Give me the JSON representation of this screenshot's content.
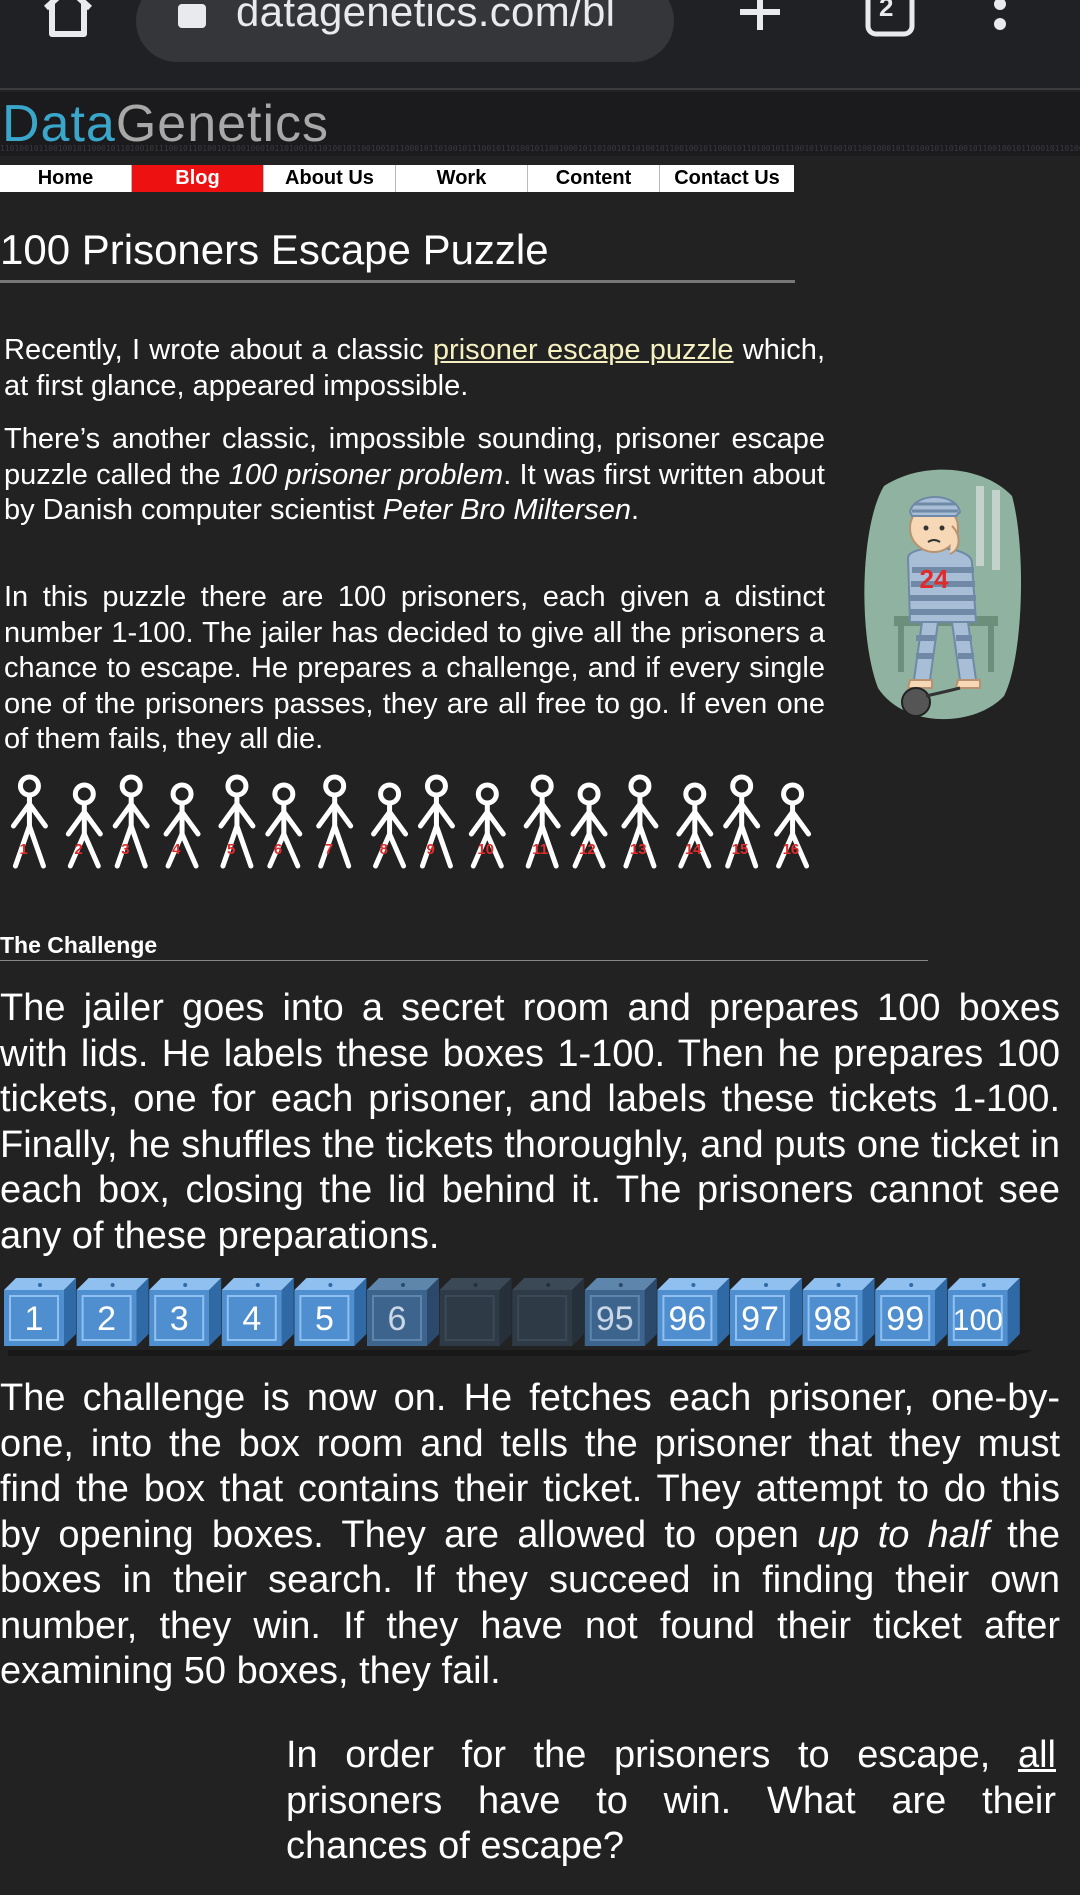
{
  "browser": {
    "url": "datagenetics.com/bl",
    "tab_count": "2",
    "icons": [
      "home-icon",
      "lock-icon",
      "plus-icon",
      "tabs-icon",
      "more-vert-icon"
    ]
  },
  "site": {
    "logo_part1": "Data",
    "logo_part2": "Genetics",
    "binary_strip": "1101001011001001011000101101001011100101101001011001000101101001011010010110010010110001011010010111001011010010110010001011010010110100101100100101100010110100101110010110100101100100010110100101101001011001001011000101101001011100101101001011001000101101001011010010110010010110001011010010111001011010010110010001011010010110100101100100101100010110100101110010110"
  },
  "nav": {
    "items": [
      {
        "label": "Home",
        "active": false
      },
      {
        "label": "Blog",
        "active": true
      },
      {
        "label": "About Us",
        "active": false
      },
      {
        "label": "Work",
        "active": false
      },
      {
        "label": "Content",
        "active": false
      },
      {
        "label": "Contact Us",
        "active": false
      }
    ]
  },
  "article": {
    "title": "100 Prisoners Escape Puzzle",
    "p1_before": "Recently, I wrote about a classic ",
    "p1_link": "prisoner escape puzzle",
    "p1_after": " which, at first glance, appeared impossible.",
    "p2_a": "There’s another classic, impossible sounding, prisoner escape puzzle called the ",
    "p2_em1": "100 prisoner problem",
    "p2_b": ". It was first written about by Danish computer scientist ",
    "p2_em2": "Peter Bro Miltersen",
    "p2_c": ".",
    "p3": "In this puzzle there are 100 prisoners, each given a distinct number 1-100. The jailer has decided to give all the prisoners a chance to escape. He prepares a challenge, and if every single one of the prisoners passes, they are all free to go. If even one of them fails, they all die.",
    "prisoner_badge": "24",
    "stick_numbers": [
      "1",
      "2",
      "3",
      "4",
      "5",
      "6",
      "7",
      "8",
      "9",
      "10",
      "11",
      "12",
      "13",
      "14",
      "15",
      "16"
    ],
    "challenge_heading": "The Challenge",
    "p4": "The jailer goes into a secret room and prepares 100 boxes with lids. He labels these boxes 1-100. Then he prepares 100 tickets, one for each prisoner, and labels these tickets 1-100. Finally, he shuffles the tickets thoroughly, and puts one ticket in each box, closing the lid behind it. The prisoners cannot see any of these preparations.",
    "boxes": [
      {
        "label": "1",
        "style": "bright"
      },
      {
        "label": "2",
        "style": "bright"
      },
      {
        "label": "3",
        "style": "bright"
      },
      {
        "label": "4",
        "style": "bright"
      },
      {
        "label": "5",
        "style": "bright"
      },
      {
        "label": "6",
        "style": "fade1"
      },
      {
        "label": "",
        "style": "fade2"
      },
      {
        "label": "",
        "style": "fade2"
      },
      {
        "label": "95",
        "style": "fade1"
      },
      {
        "label": "96",
        "style": "bright"
      },
      {
        "label": "97",
        "style": "bright"
      },
      {
        "label": "98",
        "style": "bright"
      },
      {
        "label": "99",
        "style": "bright"
      },
      {
        "label": "100",
        "style": "bright"
      }
    ],
    "p5_a": "The challenge is now on. He fetches each prisoner, one-by-one, into the box room and tells the prisoner that they must find the box that contains their ticket. They attempt to do this by opening boxes. They are allowed to open ",
    "p5_em": "up to half",
    "p5_b": " the boxes in their search. If they succeed in finding their own number, they win. If they have not found their ticket after examining 50 boxes, they fail.",
    "p6_a": "In order for the prisoners to escape, ",
    "p6_ul": "all",
    "p6_b": " prisoners have to win. What are their chances of escape?"
  },
  "colors": {
    "page_bg": "#222222",
    "nav_active": "#ee1111",
    "logo_data": "#3aa6c9",
    "logo_genetics": "#a8a8a8",
    "link": "#f5f0c0",
    "box_blue": "#4f8fd0"
  }
}
